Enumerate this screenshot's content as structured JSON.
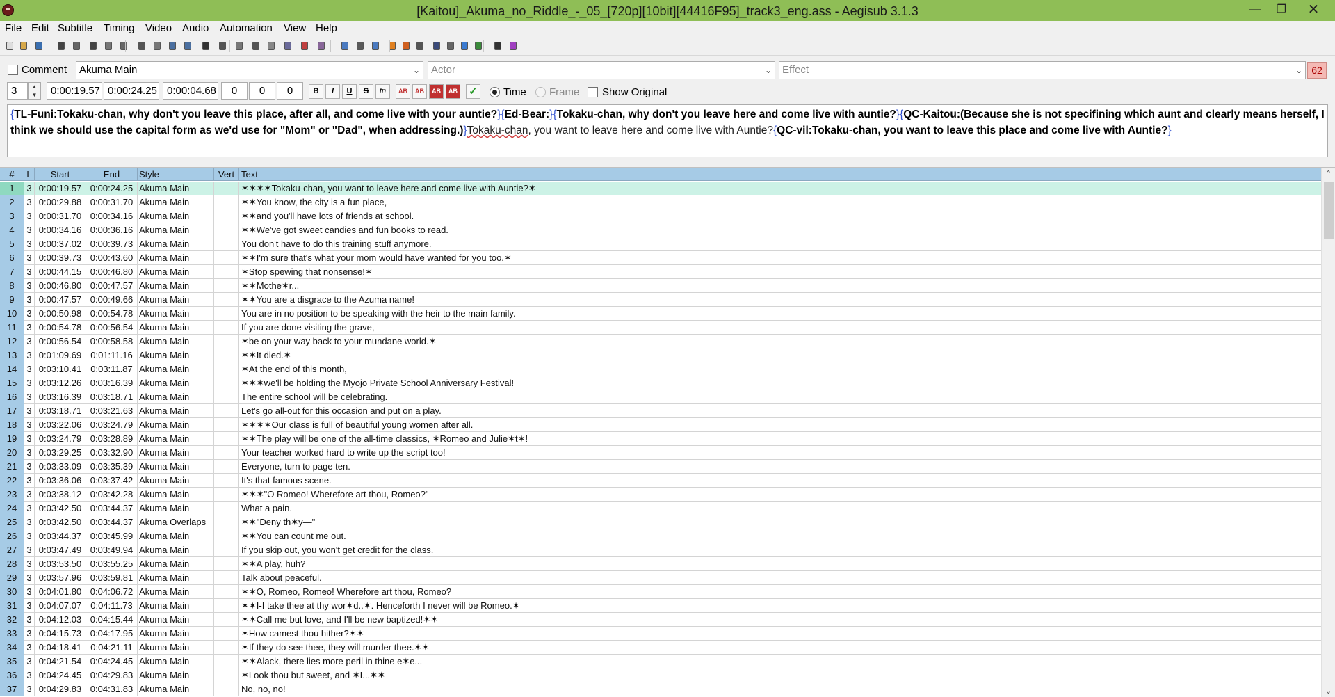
{
  "window": {
    "title": "[Kaitou]_Akuma_no_Riddle_-_05_[720p][10bit][44416F95]_track3_eng.ass - Aegisub 3.1.3",
    "minimize": "—",
    "maximize": "❐",
    "close": "✕"
  },
  "menu": [
    "File",
    "Edit",
    "Subtitle",
    "Timing",
    "Video",
    "Audio",
    "Automation",
    "View",
    "Help"
  ],
  "toolbar_icons": [
    "new-file-icon",
    "open-file-icon",
    "save-file-icon",
    "jump-to-icon",
    "find-icon",
    "find-replace-icon",
    "styles-manager-icon",
    "attachments-icon",
    "fonts-collector-icon",
    "properties-icon",
    "styling-assistant-icon",
    "translation-assistant-icon",
    "resample-icon",
    "timing-post-processor-icon",
    "kanji-timer-icon",
    "spell-checker-icon",
    "shift-times-icon",
    "select-lines-icon",
    "automation-icon",
    "options-icon",
    "zoom-icon",
    "snap-start-icon",
    "snap-end-icon",
    "video-jump-icon",
    "video-start-icon",
    "video-end-icon",
    "keyframe-icon",
    "clock-icon",
    "sort-icon",
    "check-icon",
    "tools-icon",
    "help-icon"
  ],
  "editor": {
    "comment_label": "Comment",
    "style": "Akuma Main",
    "actor_placeholder": "Actor",
    "effect_placeholder": "Effect",
    "char_count": "62",
    "layer": "3",
    "start_time": "0:00:19.57",
    "end_time": "0:00:24.25",
    "duration": "0:00:04.68",
    "margin_l": "0",
    "margin_r": "0",
    "margin_v": "0",
    "bold": "B",
    "italic": "I",
    "underline": "U",
    "strike": "S",
    "fn": "fn",
    "color1": "AB",
    "color2": "AB",
    "color3": "AB",
    "color4": "AB",
    "commit": "✓",
    "time_label": "Time",
    "frame_label": "Frame",
    "show_original_label": "Show Original",
    "text": {
      "brace_open": "{",
      "brace_close": "}",
      "tl_note": "TL-Funi:Tokaku-chan, why don't you leave this place, after all, and come live with your auntie?",
      "ed_note": "Ed-Bear:",
      "ed_text": "Tokaku-chan, why don't you leave here and come live with auntie?",
      "qc_note": "QC-Kaitou:(Because she is not specifining which aunt and clearly means herself, I think we should use the capital form as we'd use for \"Mom\" or \"Dad\", when addressing.)",
      "main_word": "Tokaku-chan",
      "main_rest": ", you want to leave here and come live with Auntie?",
      "qc2_note": "QC-vil:Tokaku-chan, you want to leave this place and come live with Auntie?"
    }
  },
  "grid": {
    "headers": {
      "num": "#",
      "layer": "L",
      "start": "Start",
      "end": "End",
      "style": "Style",
      "vert": "Vert",
      "text": "Text"
    },
    "rows": [
      {
        "num": "1",
        "l": "3",
        "start": "0:00:19.57",
        "end": "0:00:24.25",
        "style": "Akuma Main",
        "text": "✶✶✶✶Tokaku-chan, you want to leave here and come live with Auntie?✶",
        "selected": true
      },
      {
        "num": "2",
        "l": "3",
        "start": "0:00:29.88",
        "end": "0:00:31.70",
        "style": "Akuma Main",
        "text": "✶✶You know, the city is a fun place,"
      },
      {
        "num": "3",
        "l": "3",
        "start": "0:00:31.70",
        "end": "0:00:34.16",
        "style": "Akuma Main",
        "text": "✶✶and you'll have lots of friends at school."
      },
      {
        "num": "4",
        "l": "3",
        "start": "0:00:34.16",
        "end": "0:00:36.16",
        "style": "Akuma Main",
        "text": "✶✶We've got sweet candies and fun books to read."
      },
      {
        "num": "5",
        "l": "3",
        "start": "0:00:37.02",
        "end": "0:00:39.73",
        "style": "Akuma Main",
        "text": "You don't have to do this training stuff anymore."
      },
      {
        "num": "6",
        "l": "3",
        "start": "0:00:39.73",
        "end": "0:00:43.60",
        "style": "Akuma Main",
        "text": "✶✶I'm sure that's what your mom would have wanted for you too.✶"
      },
      {
        "num": "7",
        "l": "3",
        "start": "0:00:44.15",
        "end": "0:00:46.80",
        "style": "Akuma Main",
        "text": "✶Stop spewing that nonsense!✶"
      },
      {
        "num": "8",
        "l": "3",
        "start": "0:00:46.80",
        "end": "0:00:47.57",
        "style": "Akuma Main",
        "text": "✶✶Mothe✶r..."
      },
      {
        "num": "9",
        "l": "3",
        "start": "0:00:47.57",
        "end": "0:00:49.66",
        "style": "Akuma Main",
        "text": "✶✶You are a disgrace to the Azuma name!"
      },
      {
        "num": "10",
        "l": "3",
        "start": "0:00:50.98",
        "end": "0:00:54.78",
        "style": "Akuma Main",
        "text": "You are in no position to be speaking with the heir to the main family."
      },
      {
        "num": "11",
        "l": "3",
        "start": "0:00:54.78",
        "end": "0:00:56.54",
        "style": "Akuma Main",
        "text": "If you are done visiting the grave,"
      },
      {
        "num": "12",
        "l": "3",
        "start": "0:00:56.54",
        "end": "0:00:58.58",
        "style": "Akuma Main",
        "text": "✶be on your way back to your mundane world.✶"
      },
      {
        "num": "13",
        "l": "3",
        "start": "0:01:09.69",
        "end": "0:01:11.16",
        "style": "Akuma Main",
        "text": "✶✶It died.✶"
      },
      {
        "num": "14",
        "l": "3",
        "start": "0:03:10.41",
        "end": "0:03:11.87",
        "style": "Akuma Main",
        "text": "✶At the end of this month,"
      },
      {
        "num": "15",
        "l": "3",
        "start": "0:03:12.26",
        "end": "0:03:16.39",
        "style": "Akuma Main",
        "text": "✶✶✶we'll be holding the Myojo Private School Anniversary Festival!"
      },
      {
        "num": "16",
        "l": "3",
        "start": "0:03:16.39",
        "end": "0:03:18.71",
        "style": "Akuma Main",
        "text": "The entire school will be celebrating."
      },
      {
        "num": "17",
        "l": "3",
        "start": "0:03:18.71",
        "end": "0:03:21.63",
        "style": "Akuma Main",
        "text": "Let's go all-out for this occasion and put on a play."
      },
      {
        "num": "18",
        "l": "3",
        "start": "0:03:22.06",
        "end": "0:03:24.79",
        "style": "Akuma Main",
        "text": "✶✶✶✶Our class is full of beautiful young women after all."
      },
      {
        "num": "19",
        "l": "3",
        "start": "0:03:24.79",
        "end": "0:03:28.89",
        "style": "Akuma Main",
        "text": "✶✶The play will be one of the all-time classics, ✶Romeo and Julie✶t✶!"
      },
      {
        "num": "20",
        "l": "3",
        "start": "0:03:29.25",
        "end": "0:03:32.90",
        "style": "Akuma Main",
        "text": "Your teacher worked hard to write up the script too!"
      },
      {
        "num": "21",
        "l": "3",
        "start": "0:03:33.09",
        "end": "0:03:35.39",
        "style": "Akuma Main",
        "text": "Everyone, turn to page ten."
      },
      {
        "num": "22",
        "l": "3",
        "start": "0:03:36.06",
        "end": "0:03:37.42",
        "style": "Akuma Main",
        "text": "It's that famous scene."
      },
      {
        "num": "23",
        "l": "3",
        "start": "0:03:38.12",
        "end": "0:03:42.28",
        "style": "Akuma Main",
        "text": "✶✶✶\"O Romeo! Wherefore art thou, Romeo?\""
      },
      {
        "num": "24",
        "l": "3",
        "start": "0:03:42.50",
        "end": "0:03:44.37",
        "style": "Akuma Main",
        "text": "What a pain."
      },
      {
        "num": "25",
        "l": "3",
        "start": "0:03:42.50",
        "end": "0:03:44.37",
        "style": "Akuma Overlaps",
        "text": "✶✶\"Deny th✶y—\""
      },
      {
        "num": "26",
        "l": "3",
        "start": "0:03:44.37",
        "end": "0:03:45.99",
        "style": "Akuma Main",
        "text": "✶✶You can count me out."
      },
      {
        "num": "27",
        "l": "3",
        "start": "0:03:47.49",
        "end": "0:03:49.94",
        "style": "Akuma Main",
        "text": "If you skip out, you won't get credit for the class."
      },
      {
        "num": "28",
        "l": "3",
        "start": "0:03:53.50",
        "end": "0:03:55.25",
        "style": "Akuma Main",
        "text": "✶✶A play, huh?"
      },
      {
        "num": "29",
        "l": "3",
        "start": "0:03:57.96",
        "end": "0:03:59.81",
        "style": "Akuma Main",
        "text": "Talk about peaceful."
      },
      {
        "num": "30",
        "l": "3",
        "start": "0:04:01.80",
        "end": "0:04:06.72",
        "style": "Akuma Main",
        "text": "✶✶O, Romeo, Romeo! Wherefore art thou, Romeo?"
      },
      {
        "num": "31",
        "l": "3",
        "start": "0:04:07.07",
        "end": "0:04:11.73",
        "style": "Akuma Main",
        "text": "✶✶I-I take thee at thy wor✶d..✶. Henceforth I never will be Romeo.✶"
      },
      {
        "num": "32",
        "l": "3",
        "start": "0:04:12.03",
        "end": "0:04:15.44",
        "style": "Akuma Main",
        "text": "✶✶Call me but love, and I'll be new baptized!✶✶"
      },
      {
        "num": "33",
        "l": "3",
        "start": "0:04:15.73",
        "end": "0:04:17.95",
        "style": "Akuma Main",
        "text": "✶How camest thou hither?✶✶"
      },
      {
        "num": "34",
        "l": "3",
        "start": "0:04:18.41",
        "end": "0:04:21.11",
        "style": "Akuma Main",
        "text": "✶If they do see thee, they will murder thee.✶✶"
      },
      {
        "num": "35",
        "l": "3",
        "start": "0:04:21.54",
        "end": "0:04:24.45",
        "style": "Akuma Main",
        "text": "✶✶Alack, there lies more peril in thine e✶e..."
      },
      {
        "num": "36",
        "l": "3",
        "start": "0:04:24.45",
        "end": "0:04:29.83",
        "style": "Akuma Main",
        "text": "✶Look thou but sweet, and ✶I...✶✶"
      },
      {
        "num": "37",
        "l": "3",
        "start": "0:04:29.83",
        "end": "0:04:31.83",
        "style": "Akuma Main",
        "text": "No, no, no!"
      }
    ]
  },
  "colors": {
    "titlebar": "#8fbe56",
    "grid_header": "#a6cbe6",
    "selected_row": "#ccf2e6",
    "char_count_bg": "#f4b9b4"
  }
}
